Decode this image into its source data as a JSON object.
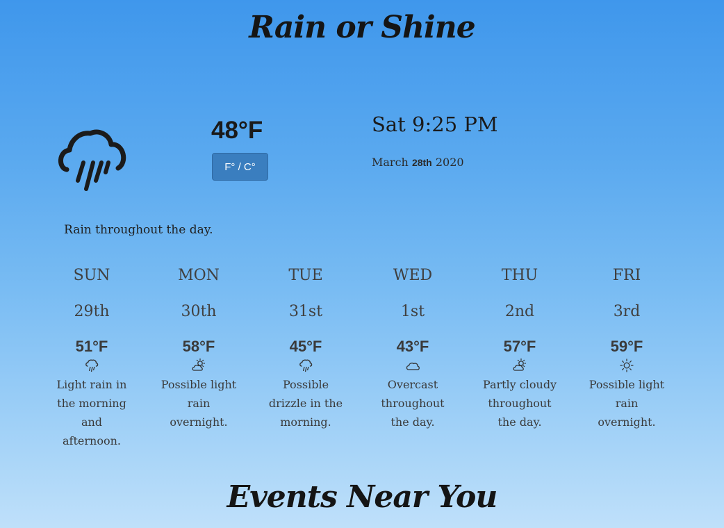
{
  "app": {
    "title": "Rain or Shine"
  },
  "current": {
    "temperature": "48°F",
    "unit_toggle_label": "F° / C°",
    "time": "Sat 9:25 PM",
    "date_month": "March",
    "date_day": "28th",
    "date_year": "2020",
    "summary": "Rain throughout the day.",
    "icon": "rain-icon"
  },
  "forecast": [
    {
      "day": "SUN",
      "date": "29th",
      "temp": "51°F",
      "icon": "rain-icon",
      "desc": [
        "Light rain in",
        "the morning",
        "and",
        "afternoon."
      ]
    },
    {
      "day": "MON",
      "date": "30th",
      "temp": "58°F",
      "icon": "partly-cloudy-icon",
      "desc": [
        "Possible light",
        "rain",
        "overnight."
      ]
    },
    {
      "day": "TUE",
      "date": "31st",
      "temp": "45°F",
      "icon": "rain-icon",
      "desc": [
        "Possible",
        "drizzle in the",
        "morning."
      ]
    },
    {
      "day": "WED",
      "date": "1st",
      "temp": "43°F",
      "icon": "cloud-icon",
      "desc": [
        "Overcast",
        "throughout",
        "the day."
      ]
    },
    {
      "day": "THU",
      "date": "2nd",
      "temp": "57°F",
      "icon": "partly-cloudy-icon",
      "desc": [
        "Partly cloudy",
        "throughout",
        "the day."
      ]
    },
    {
      "day": "FRI",
      "date": "3rd",
      "temp": "59°F",
      "icon": "sun-icon",
      "desc": [
        "Possible light",
        "rain",
        "overnight."
      ]
    }
  ],
  "events": {
    "title": "Events Near You"
  }
}
